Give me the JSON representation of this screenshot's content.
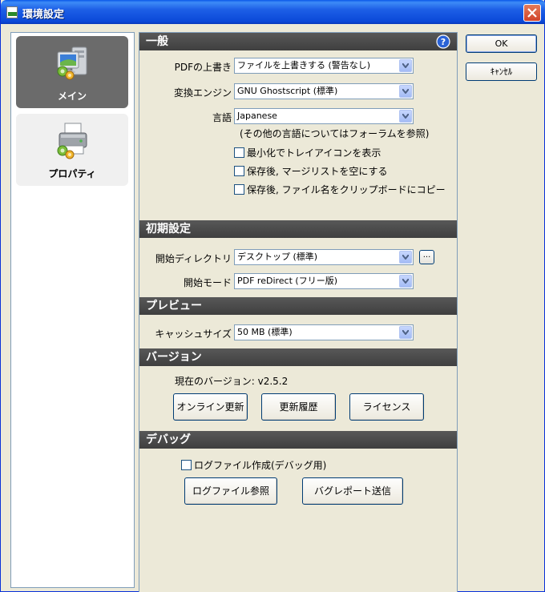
{
  "window": {
    "title": "環境設定",
    "accent": "#0a48d8"
  },
  "nav": {
    "main_label": "メイン",
    "properties_label": "プロパティ"
  },
  "general": {
    "header": "一般",
    "overwrite_label": "PDFの上書き",
    "overwrite_value": "ファイルを上書きする (警告なし)",
    "engine_label": "変換エンジン",
    "engine_value": "GNU Ghostscript (標準)",
    "language_label": "言語",
    "language_value": "Japanese",
    "language_note": "(その他の言語についてはフォーラムを参照)",
    "check_tray": "最小化でトレイアイコンを表示",
    "check_clear": "保存後, マージリストを空にする",
    "check_copy": "保存後, ファイル名をクリップボードにコピー"
  },
  "initial": {
    "header": "初期設定",
    "dir_label": "開始ディレクトリ",
    "dir_value": "デスクトップ (標準)",
    "browse_label": "...",
    "mode_label": "開始モード",
    "mode_value": "PDF reDirect (フリー版)"
  },
  "preview": {
    "header": "プレビュー",
    "cache_label": "キャッシュサイズ",
    "cache_value": "50 MB (標準)"
  },
  "version": {
    "header": "バージョン",
    "current": "現在のバージョン: v2.5.2",
    "online_update": "オンライン更新",
    "history": "更新履歴",
    "license": "ライセンス"
  },
  "debug": {
    "header": "デバッグ",
    "log_check": "ログファイル作成(デバッグ用)",
    "view_log": "ログファイル参照",
    "send_bug": "バグレポート送信"
  },
  "side": {
    "ok": "OK",
    "cancel": "ｷｬﾝｾﾙ"
  }
}
